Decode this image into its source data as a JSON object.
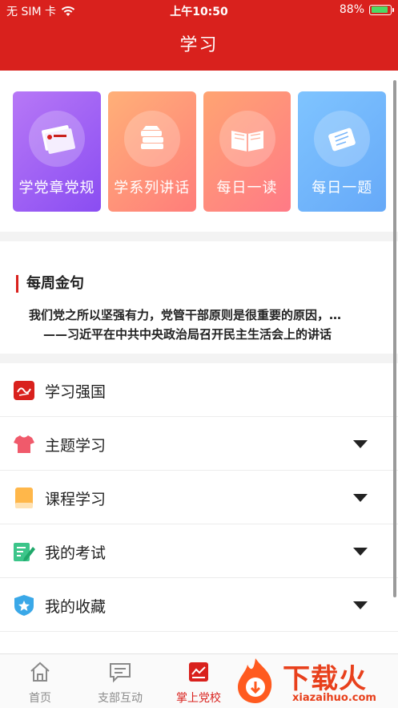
{
  "status_bar": {
    "carrier": "无 SIM 卡",
    "time": "上午10:50",
    "battery": "88%",
    "battery_level": 0.88
  },
  "header": {
    "title": "学习"
  },
  "cards": [
    {
      "label": "学党章党规",
      "icon": "party-book-icon"
    },
    {
      "label": "学系列讲话",
      "icon": "book-stack-icon"
    },
    {
      "label": "每日一读",
      "icon": "open-book-icon"
    },
    {
      "label": "每日一题",
      "icon": "question-sheet-icon"
    }
  ],
  "weekly_quote": {
    "heading": "每周金句",
    "text": "我们党之所以坚强有力，党管干部原则是很重要的原因，…",
    "source": "——习近平在中共中央政治局召开民主生活会上的讲话"
  },
  "menu": [
    {
      "label": "学习强国",
      "icon": "xuexi-qiangguo-icon",
      "expandable": false
    },
    {
      "label": "主题学习",
      "icon": "shirt-icon",
      "expandable": true
    },
    {
      "label": "课程学习",
      "icon": "notebook-icon",
      "expandable": true
    },
    {
      "label": "我的考试",
      "icon": "exam-edit-icon",
      "expandable": true
    },
    {
      "label": "我的收藏",
      "icon": "star-shield-icon",
      "expandable": true
    }
  ],
  "tabbar": {
    "items": [
      {
        "label": "首页",
        "icon": "home-icon",
        "active": false
      },
      {
        "label": "支部互动",
        "icon": "chat-icon",
        "active": false
      },
      {
        "label": "掌上党校",
        "icon": "study-icon",
        "active": true
      }
    ]
  },
  "watermark": {
    "text": "下载火",
    "url": "xiazaihuo.com"
  },
  "colors": {
    "brand_red": "#d9211d"
  }
}
